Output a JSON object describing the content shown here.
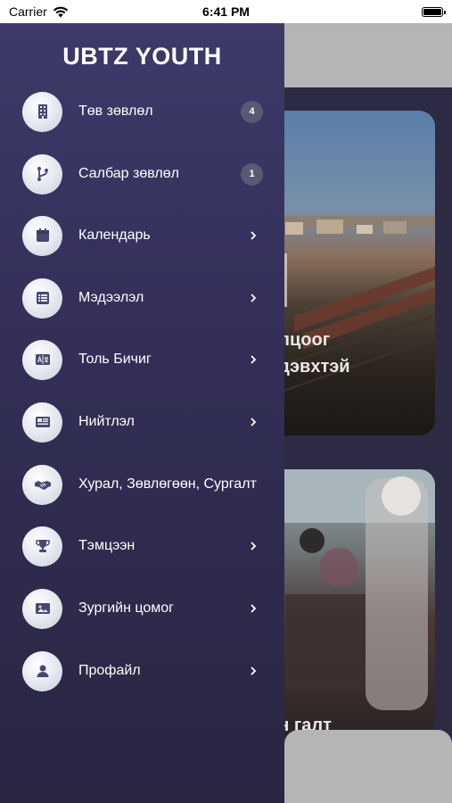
{
  "status_bar": {
    "carrier": "Carrier",
    "time": "6:41 PM"
  },
  "drawer": {
    "title": "UBTZ YOUTH",
    "items": [
      {
        "label": "Төв зөвлөл",
        "icon": "building-icon",
        "badge": "4"
      },
      {
        "label": "Салбар зөвлөл",
        "icon": "branch-icon",
        "badge": "1"
      },
      {
        "label": "Календарь",
        "icon": "calendar-icon",
        "badge": ""
      },
      {
        "label": "Мэдээлэл",
        "icon": "list-icon",
        "badge": ""
      },
      {
        "label": "Толь Бичиг",
        "icon": "dictionary-icon",
        "badge": ""
      },
      {
        "label": "Нийтлэл",
        "icon": "article-icon",
        "badge": ""
      },
      {
        "label": "Хурал, Зөвлөгөөн, Сургалт",
        "icon": "handshake-icon",
        "badge": ""
      },
      {
        "label": "Тэмцээн",
        "icon": "trophy-icon",
        "badge": ""
      },
      {
        "label": "Зургийн цомог",
        "icon": "image-icon",
        "badge": ""
      },
      {
        "label": "Профайл",
        "icon": "person-icon",
        "badge": ""
      }
    ]
  },
  "background": {
    "card1_text_line1": "илцоог",
    "card1_text_line2": "идэвхтэй",
    "card2_text": "йн галт"
  }
}
